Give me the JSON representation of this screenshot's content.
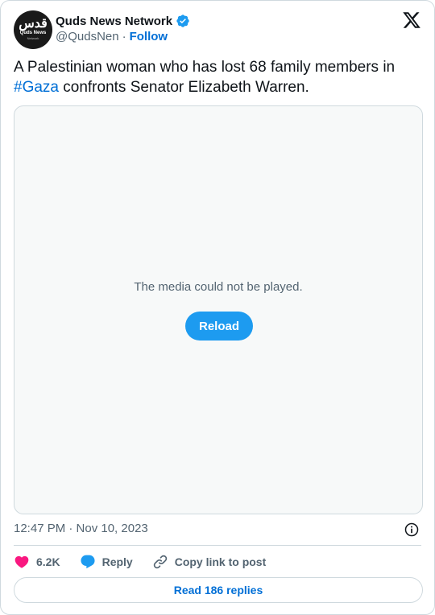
{
  "author": {
    "display_name": "Quds News Network",
    "handle": "@QudsNen",
    "separator": "·",
    "follow_label": "Follow",
    "avatar_text_main": "قدس",
    "avatar_text_sub": "Quds News",
    "avatar_text_sub2": "Network"
  },
  "tweet": {
    "text_before": "A Palestinian woman who has lost 68 family members in ",
    "hashtag": "#Gaza",
    "text_after": " confronts Senator Elizabeth Warren."
  },
  "media": {
    "message": "The media could not be played.",
    "reload_label": "Reload"
  },
  "timestamp": "12:47 PM · Nov 10, 2023",
  "actions": {
    "likes_count": "6.2K",
    "reply_label": "Reply",
    "copy_link_label": "Copy link to post"
  },
  "read_replies_label": "Read 186 replies",
  "colors": {
    "accent": "#1d9bf0",
    "link": "#006fd6",
    "like": "#f91880",
    "muted": "#536471"
  },
  "icons": [
    "verified-badge-icon",
    "x-logo-icon",
    "info-icon",
    "heart-icon",
    "reply-bubble-icon",
    "link-icon"
  ]
}
